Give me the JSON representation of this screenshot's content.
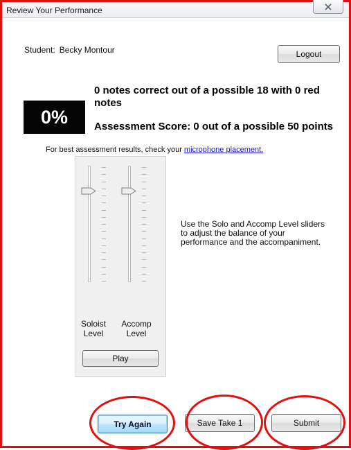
{
  "window": {
    "title": "Review Your Performance",
    "close_glyph": "X"
  },
  "student": {
    "label": "Student:",
    "name": "Becky Montour"
  },
  "header": {
    "logout_label": "Logout"
  },
  "results": {
    "percent": "0%",
    "summary": "0 notes correct out of a possible 18 with 0 red notes",
    "score": "Assessment Score: 0 out of a possible 50 points",
    "hint_prefix": "For best assessment results, check your",
    "hint_link": "microphone placement."
  },
  "mixer": {
    "soloist_label_1": "Soloist",
    "soloist_label_2": "Level",
    "accomp_label_1": "Accomp",
    "accomp_label_2": "Level",
    "soloist_level": 0.8,
    "accomp_level": 0.8,
    "play_label": "Play",
    "instructions": "Use the Solo and Accomp Level sliders to adjust the balance of your performance and the accompaniment."
  },
  "actions": {
    "try_again_label": "Try Again",
    "save_take_label": "Save Take 1",
    "submit_label": "Submit"
  },
  "colors": {
    "annotation_red": "#e01010",
    "percent_bg": "#050505",
    "link_blue": "#1a1ad6"
  },
  "icons": {
    "close": "close-icon",
    "slider_thumb": "slider-thumb-icon"
  }
}
